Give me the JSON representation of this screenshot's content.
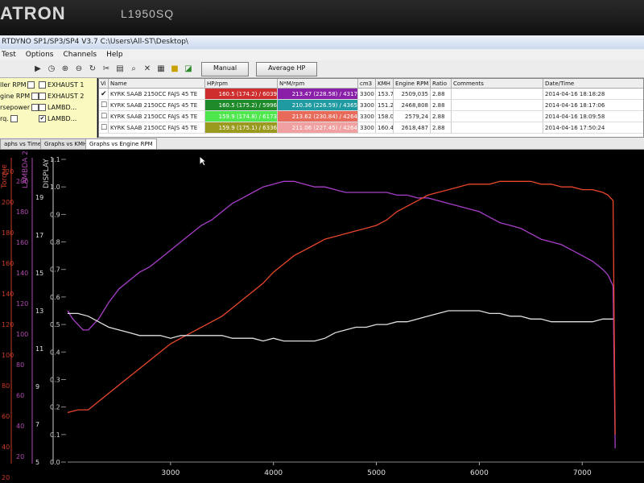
{
  "monitor": {
    "brand": "ATRON",
    "model": "L1950SQ"
  },
  "window": {
    "title": "RTDYNO SP1/SP3/SP4 V3.7 C:\\Users\\All-ST\\Desktop\\"
  },
  "menu": [
    "Test",
    "Options",
    "Channels",
    "Help"
  ],
  "toolbar": {
    "manual_label": "Manual",
    "average_label": "Average HP"
  },
  "channels": [
    {
      "label": "ller RPM",
      "checked": false
    },
    {
      "label": "EXHAUST 1",
      "checked": false
    },
    {
      "label": "gine RPM",
      "checked": false
    },
    {
      "label": "EXHAUST 2",
      "checked": false
    },
    {
      "label": "rsepower",
      "checked": false
    },
    {
      "label": "LAMBD...",
      "checked": false
    },
    {
      "label": "rq.",
      "checked": false
    },
    {
      "label": "LAMBD...",
      "checked": true
    }
  ],
  "table": {
    "headers": [
      "Vi",
      "Name",
      "HP/rpm",
      "N*M/rpm",
      "cm3",
      "KMH",
      "Engine RPM",
      "Ratio",
      "Comments",
      "Date/Time"
    ],
    "rows": [
      {
        "visible": true,
        "name": "KYRK SAAB 2150CC FAJS 45 TE",
        "hp": "160.5 (174.2) / 6039",
        "hp_color": "#cf2e2e",
        "nm": "213.47 (228.58) / 4317",
        "nm_color": "#8a1fa8",
        "cm3": "3300",
        "kmh": "153.7",
        "rpm": "2509,035",
        "ratio": "2.88",
        "comments": "",
        "date": "2014-04-16 18:18:28"
      },
      {
        "visible": false,
        "name": "KYRK SAAB 2150CC FAJS 45 TE",
        "hp": "160.5 (175.2) / 5996",
        "hp_color": "#1e8a2a",
        "nm": "210.36 (226.59) / 4365",
        "nm_color": "#1f9aa0",
        "cm3": "3300",
        "kmh": "151.2",
        "rpm": "2468,808",
        "ratio": "2.88",
        "comments": "",
        "date": "2014-04-16 18:17:06"
      },
      {
        "visible": false,
        "name": "KYRK SAAB 2150CC FAJS 45 TE",
        "hp": "159.9 (174.8) / 6173",
        "hp_color": "#4ee84e",
        "nm": "213.62 (230.84) / 4264",
        "nm_color": "#e86a5a",
        "cm3": "3300",
        "kmh": "158.0",
        "rpm": "2579,24",
        "ratio": "2.88",
        "comments": "",
        "date": "2014-04-16 18:09:58"
      },
      {
        "visible": false,
        "name": "KYRK SAAB 2150CC FAJS 45 TE",
        "hp": "159.9 (175.1) / 6336",
        "hp_color": "#9a9a1e",
        "nm": "211.06 (227.45) / 4264",
        "nm_color": "#f0a0a0",
        "cm3": "3300",
        "kmh": "160.4",
        "rpm": "2618,487",
        "ratio": "2.88",
        "comments": "",
        "date": "2014-04-16 17:50:24"
      }
    ]
  },
  "tabs": [
    "aphs vs Time",
    "Graphs vs KMH",
    "Graphs vs Engine RPM"
  ],
  "active_tab": 2,
  "chart_data": {
    "type": "line",
    "xlabel": "",
    "xlim": [
      2000,
      7600
    ],
    "x_ticks": [
      "3000",
      "4000",
      "5000",
      "6000",
      "7000"
    ],
    "axes": [
      {
        "name": "Torque",
        "color": "#cc3a2a",
        "ticks": [
          "200"
        ]
      },
      {
        "name": "LAMBDA 2",
        "color": "#b04ab0",
        "ticks": [
          "200",
          "180",
          "160",
          "140",
          "120",
          "100",
          "80",
          "60",
          "40",
          "20"
        ]
      },
      {
        "name": "DISPLAY",
        "color": "#d0d0d0",
        "ticks": [
          "1.1",
          "1.0",
          "0.9",
          "0.8",
          "0.7",
          "0.6",
          "0.5",
          "0.4",
          "0.3",
          "0.2",
          "0.1",
          "0.0"
        ]
      }
    ],
    "lambda_ticks": [
      "19",
      "17",
      "15",
      "13",
      "11",
      "9",
      "7",
      "5",
      "3"
    ],
    "left_ticks": [
      "220",
      "200",
      "180",
      "160",
      "140",
      "120",
      "100",
      "80",
      "60",
      "40",
      "20"
    ],
    "ylim": [
      0,
      1.1
    ],
    "series": [
      {
        "color": "#a83ec8",
        "x": [
          2000,
          2050,
          2100,
          2150,
          2200,
          2300,
          2400,
          2500,
          2600,
          2700,
          2800,
          2900,
          3000,
          3100,
          3200,
          3300,
          3400,
          3500,
          3600,
          3700,
          3800,
          3900,
          4000,
          4100,
          4200,
          4300,
          4400,
          4500,
          4600,
          4700,
          4800,
          4900,
          5000,
          5100,
          5200,
          5300,
          5400,
          5500,
          5600,
          5700,
          5800,
          5900,
          6000,
          6100,
          6200,
          6300,
          6400,
          6500,
          6600,
          6700,
          6800,
          6900,
          7000,
          7100,
          7200,
          7250,
          7300,
          7320
        ],
        "y": [
          0.55,
          0.52,
          0.5,
          0.48,
          0.48,
          0.52,
          0.58,
          0.63,
          0.66,
          0.69,
          0.71,
          0.74,
          0.77,
          0.8,
          0.83,
          0.86,
          0.88,
          0.91,
          0.94,
          0.96,
          0.98,
          1.0,
          1.01,
          1.02,
          1.02,
          1.01,
          1.0,
          1.0,
          0.99,
          0.98,
          0.98,
          0.98,
          0.98,
          0.98,
          0.97,
          0.97,
          0.96,
          0.96,
          0.95,
          0.94,
          0.93,
          0.92,
          0.91,
          0.89,
          0.87,
          0.86,
          0.85,
          0.83,
          0.81,
          0.8,
          0.79,
          0.77,
          0.75,
          0.73,
          0.7,
          0.68,
          0.64,
          0.05
        ]
      },
      {
        "color": "#e8462c",
        "x": [
          2000,
          2100,
          2200,
          2300,
          2400,
          2500,
          2600,
          2700,
          2800,
          2900,
          3000,
          3100,
          3200,
          3300,
          3400,
          3500,
          3600,
          3700,
          3800,
          3900,
          4000,
          4100,
          4200,
          4300,
          4400,
          4500,
          4600,
          4700,
          4800,
          4900,
          5000,
          5100,
          5200,
          5300,
          5400,
          5500,
          5600,
          5700,
          5800,
          5900,
          6000,
          6100,
          6200,
          6300,
          6400,
          6500,
          6600,
          6700,
          6800,
          6900,
          7000,
          7100,
          7200,
          7250,
          7300,
          7320
        ],
        "y": [
          0.18,
          0.19,
          0.19,
          0.22,
          0.25,
          0.28,
          0.31,
          0.34,
          0.37,
          0.4,
          0.43,
          0.45,
          0.47,
          0.49,
          0.51,
          0.53,
          0.56,
          0.59,
          0.62,
          0.65,
          0.69,
          0.72,
          0.75,
          0.77,
          0.79,
          0.81,
          0.82,
          0.83,
          0.84,
          0.85,
          0.86,
          0.88,
          0.91,
          0.93,
          0.95,
          0.97,
          0.98,
          0.99,
          1.0,
          1.01,
          1.01,
          1.01,
          1.02,
          1.02,
          1.02,
          1.02,
          1.01,
          1.01,
          1.0,
          1.0,
          0.99,
          0.99,
          0.98,
          0.97,
          0.95,
          0.1
        ]
      },
      {
        "color": "#e0e0e0",
        "x": [
          2000,
          2100,
          2200,
          2300,
          2400,
          2500,
          2600,
          2700,
          2800,
          2900,
          3000,
          3100,
          3200,
          3300,
          3400,
          3500,
          3600,
          3700,
          3800,
          3900,
          4000,
          4100,
          4200,
          4300,
          4400,
          4500,
          4600,
          4700,
          4800,
          4900,
          5000,
          5100,
          5200,
          5300,
          5400,
          5500,
          5600,
          5700,
          5800,
          5900,
          6000,
          6100,
          6200,
          6300,
          6400,
          6500,
          6600,
          6700,
          6800,
          6900,
          7000,
          7100,
          7200,
          7300
        ],
        "y": [
          0.54,
          0.54,
          0.53,
          0.51,
          0.49,
          0.48,
          0.47,
          0.46,
          0.46,
          0.46,
          0.45,
          0.46,
          0.46,
          0.46,
          0.46,
          0.46,
          0.45,
          0.45,
          0.45,
          0.44,
          0.45,
          0.44,
          0.44,
          0.44,
          0.44,
          0.45,
          0.47,
          0.48,
          0.49,
          0.49,
          0.5,
          0.5,
          0.51,
          0.51,
          0.52,
          0.53,
          0.54,
          0.55,
          0.55,
          0.55,
          0.55,
          0.54,
          0.54,
          0.53,
          0.53,
          0.52,
          0.52,
          0.51,
          0.51,
          0.51,
          0.51,
          0.51,
          0.52,
          0.52
        ]
      }
    ]
  }
}
